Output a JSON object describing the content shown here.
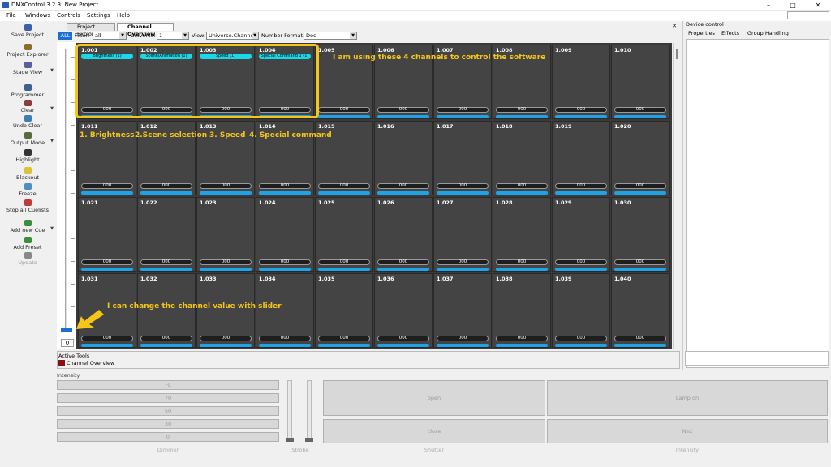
{
  "window": {
    "title": "DMXControl 3.2.3: New Project",
    "minimize": "–",
    "maximize": "□",
    "close": "✕"
  },
  "menu": [
    "File",
    "Windows",
    "Controls",
    "Settings",
    "Help"
  ],
  "toolbar": [
    {
      "label": "Save Project",
      "icon": "floppy-icon"
    },
    {
      "label": "Project Explorer",
      "icon": "folder-icon"
    },
    {
      "label": "Stage View",
      "icon": "stage-icon"
    },
    {
      "label": "Programmer",
      "icon": "programmer-icon"
    },
    {
      "label": "Clear",
      "icon": "clear-icon"
    },
    {
      "label": "Undo Clear",
      "icon": "undo-icon"
    },
    {
      "label": "Output Mode",
      "icon": "output-icon"
    },
    {
      "label": "Highlight",
      "icon": "highlight-icon"
    },
    {
      "label": "Blackout",
      "icon": "blackout-icon"
    },
    {
      "label": "Freeze",
      "icon": "freeze-icon"
    },
    {
      "label": "Stop all Cuelists",
      "icon": "stop-icon"
    },
    {
      "label": "Add new Cue",
      "icon": "add-cue-icon"
    },
    {
      "label": "Add Preset",
      "icon": "add-preset-icon"
    },
    {
      "label": "Update",
      "icon": "update-icon"
    }
  ],
  "tabs": [
    "Project Explorer",
    "Channel Overview"
  ],
  "tabs_close": "✕",
  "filterbar": {
    "all_btn": "ALL",
    "filter_label": "Filter:",
    "filter_value": "all",
    "universe_label": "Universe:",
    "universe_value": "1",
    "view_label": "View:",
    "view_value": "Universe.Channel",
    "format_label": "Number Format:",
    "format_value": "Dec"
  },
  "slider": {
    "value": "0",
    "level": 0
  },
  "channels": [
    {
      "id": "1.001",
      "fn": "Brightness (1)",
      "val": "000"
    },
    {
      "id": "1.002",
      "fn": "Scene/Animation (1)",
      "val": "000"
    },
    {
      "id": "1.003",
      "fn": "Speed (1)",
      "val": "000"
    },
    {
      "id": "1.004",
      "fn": "Special Command 1 (1)",
      "val": "000"
    },
    {
      "id": "1.005",
      "fn": "",
      "val": "000"
    },
    {
      "id": "1.006",
      "fn": "",
      "val": "000"
    },
    {
      "id": "1.007",
      "fn": "",
      "val": "000"
    },
    {
      "id": "1.008",
      "fn": "",
      "val": "000"
    },
    {
      "id": "1.009",
      "fn": "",
      "val": "000"
    },
    {
      "id": "1.010",
      "fn": "",
      "val": "000"
    },
    {
      "id": "1.011",
      "fn": "",
      "val": "000"
    },
    {
      "id": "1.012",
      "fn": "",
      "val": "000"
    },
    {
      "id": "1.013",
      "fn": "",
      "val": "000"
    },
    {
      "id": "1.014",
      "fn": "",
      "val": "000"
    },
    {
      "id": "1.015",
      "fn": "",
      "val": "000"
    },
    {
      "id": "1.016",
      "fn": "",
      "val": "000"
    },
    {
      "id": "1.017",
      "fn": "",
      "val": "000"
    },
    {
      "id": "1.018",
      "fn": "",
      "val": "000"
    },
    {
      "id": "1.019",
      "fn": "",
      "val": "000"
    },
    {
      "id": "1.020",
      "fn": "",
      "val": "000"
    },
    {
      "id": "1.021",
      "fn": "",
      "val": "000"
    },
    {
      "id": "1.022",
      "fn": "",
      "val": "000"
    },
    {
      "id": "1.023",
      "fn": "",
      "val": "000"
    },
    {
      "id": "1.024",
      "fn": "",
      "val": "000"
    },
    {
      "id": "1.025",
      "fn": "",
      "val": "000"
    },
    {
      "id": "1.026",
      "fn": "",
      "val": "000"
    },
    {
      "id": "1.027",
      "fn": "",
      "val": "000"
    },
    {
      "id": "1.028",
      "fn": "",
      "val": "000"
    },
    {
      "id": "1.029",
      "fn": "",
      "val": "000"
    },
    {
      "id": "1.030",
      "fn": "",
      "val": "000"
    },
    {
      "id": "1.031",
      "fn": "",
      "val": "000"
    },
    {
      "id": "1.032",
      "fn": "",
      "val": "000"
    },
    {
      "id": "1.033",
      "fn": "",
      "val": "000"
    },
    {
      "id": "1.034",
      "fn": "",
      "val": "000"
    },
    {
      "id": "1.035",
      "fn": "",
      "val": "000"
    },
    {
      "id": "1.036",
      "fn": "",
      "val": "000"
    },
    {
      "id": "1.037",
      "fn": "",
      "val": "000"
    },
    {
      "id": "1.038",
      "fn": "",
      "val": "000"
    },
    {
      "id": "1.039",
      "fn": "",
      "val": "000"
    },
    {
      "id": "1.040",
      "fn": "",
      "val": "000"
    }
  ],
  "annotations": {
    "top": "I am using these 4 channels to control the software",
    "a1": "1. Brightness",
    "a2": "2.Scene selection",
    "a3": "3. Speed",
    "a4": "4. Special command",
    "slider": "I can change the channel value with slider"
  },
  "active_tools": {
    "header": "Active Tools",
    "item": "Channel Overview"
  },
  "right_panel": {
    "title": "Device control",
    "tabs": [
      "Properties",
      "Effects",
      "Group Handling"
    ]
  },
  "intensity": {
    "header": "Intensity",
    "presets": [
      "FL",
      "70",
      "50",
      "30",
      "0"
    ],
    "dimmer_label": "Dimmer",
    "strobe_label": "Strobe",
    "shutter_open": "open",
    "shutter_close": "close",
    "shutter_label": "Shutter",
    "lamp_on": "Lamp on",
    "lamp_off": "Nex",
    "intensity_label": "Intensity"
  },
  "colors": {
    "accent": "#1e6ed0",
    "highlight": "#f5c518",
    "channel_tag": "#19d9e8",
    "channel_bar": "#1ea3e6"
  }
}
